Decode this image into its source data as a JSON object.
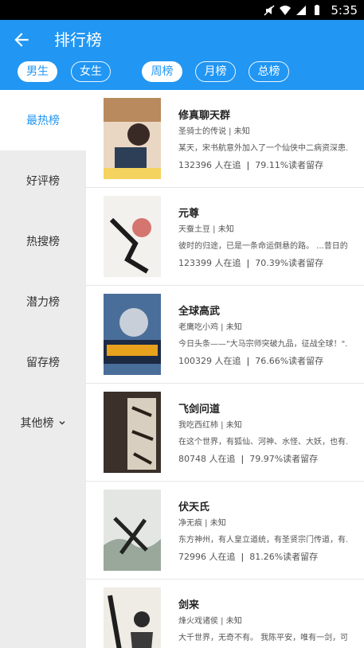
{
  "status_bar": {
    "time": "5:35"
  },
  "header": {
    "title": "排行榜"
  },
  "gender_tabs": [
    {
      "label": "男生",
      "active": true
    },
    {
      "label": "女生",
      "active": false
    }
  ],
  "period_tabs": [
    {
      "label": "周榜",
      "active": true
    },
    {
      "label": "月榜",
      "active": false
    },
    {
      "label": "总榜",
      "active": false
    }
  ],
  "sidebar": {
    "items": [
      {
        "label": "最热榜",
        "active": true
      },
      {
        "label": "好评榜",
        "active": false
      },
      {
        "label": "热搜榜",
        "active": false
      },
      {
        "label": "潜力榜",
        "active": false
      },
      {
        "label": "留存榜",
        "active": false
      },
      {
        "label": "其他榜",
        "active": false
      }
    ]
  },
  "books": [
    {
      "title": "修真聊天群",
      "meta": "圣骑士的传说 | 未知",
      "desc": "某天，宋书航意外加入了一个仙侠中二病资深患...",
      "readers": "132396 人在追",
      "retention": "79.11%读者留存"
    },
    {
      "title": "元尊",
      "meta": "天蚕土豆 | 未知",
      "desc": "彼时的归途，已是一条命运倒悬的路。 ...昔日的荣...",
      "readers": "123399 人在追",
      "retention": "70.39%读者留存"
    },
    {
      "title": "全球高武",
      "meta": "老鹰吃小鸡 | 未知",
      "desc": "今日头条——\"大马宗师突破九品，征战全球！\"...",
      "readers": "100329 人在追",
      "retention": "76.66%读者留存"
    },
    {
      "title": "飞剑问道",
      "meta": "我吃西红柿 | 未知",
      "desc": "在这个世界，有狐仙、河神、水怪、大妖，也有...",
      "readers": "80748 人在追",
      "retention": "79.97%读者留存"
    },
    {
      "title": "伏天氏",
      "meta": "净无痕 | 未知",
      "desc": "东方神州，有人皇立道统，有圣贤宗门传道，有...",
      "readers": "72996 人在追",
      "retention": "81.26%读者留存"
    },
    {
      "title": "剑来",
      "meta": "烽火戏诸侯 | 未知",
      "desc": "大千世界，无奇不有。 我陈平安，唯有一剑，可...",
      "readers": "",
      "retention": ""
    }
  ],
  "colors": {
    "primary": "#2196f3",
    "sidebar_bg": "#ececec"
  }
}
